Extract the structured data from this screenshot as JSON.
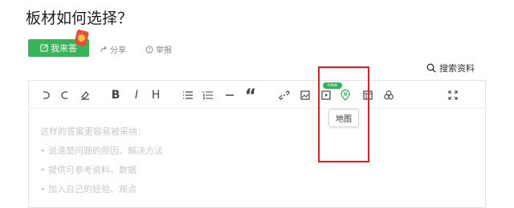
{
  "question": {
    "title": "板材如何选择？"
  },
  "actions": {
    "answer_label": "我来答",
    "share_label": "分享",
    "report_label": "举报"
  },
  "search_materials": {
    "label": "搜索资料"
  },
  "toolbar": {
    "buttons": [
      {
        "name": "undo",
        "icon": "undo-icon"
      },
      {
        "name": "redo",
        "icon": "redo-icon"
      },
      {
        "name": "clear-format",
        "icon": "eraser-icon"
      },
      {
        "name": "bold",
        "text": "B"
      },
      {
        "name": "italic",
        "text": "I"
      },
      {
        "name": "heading",
        "text": "H"
      },
      {
        "name": "unordered-list",
        "icon": "bullet-list-icon"
      },
      {
        "name": "ordered-list",
        "icon": "numbered-list-icon"
      },
      {
        "name": "divider",
        "icon": "horizontal-rule-icon"
      },
      {
        "name": "quote",
        "text": "“"
      },
      {
        "name": "link",
        "icon": "link-icon"
      },
      {
        "name": "image",
        "icon": "image-icon"
      },
      {
        "name": "video",
        "icon": "video-icon"
      },
      {
        "name": "map",
        "icon": "map-pin-icon"
      },
      {
        "name": "table",
        "icon": "table-icon"
      },
      {
        "name": "more",
        "icon": "shapes-icon"
      },
      {
        "name": "fullscreen",
        "icon": "fullscreen-icon"
      }
    ],
    "new_badge": "new",
    "map_tooltip": "地图"
  },
  "editor": {
    "placeholder_lines": [
      "这样的答案更容易被采纳：",
      "• 说清楚问题的原因、解决方法",
      "• 提供可参考资料、数据",
      "• 加入自己的经验、观点"
    ]
  },
  "colors": {
    "accent": "#38b559",
    "highlight": "#e02020",
    "badge": "#34b35a"
  }
}
